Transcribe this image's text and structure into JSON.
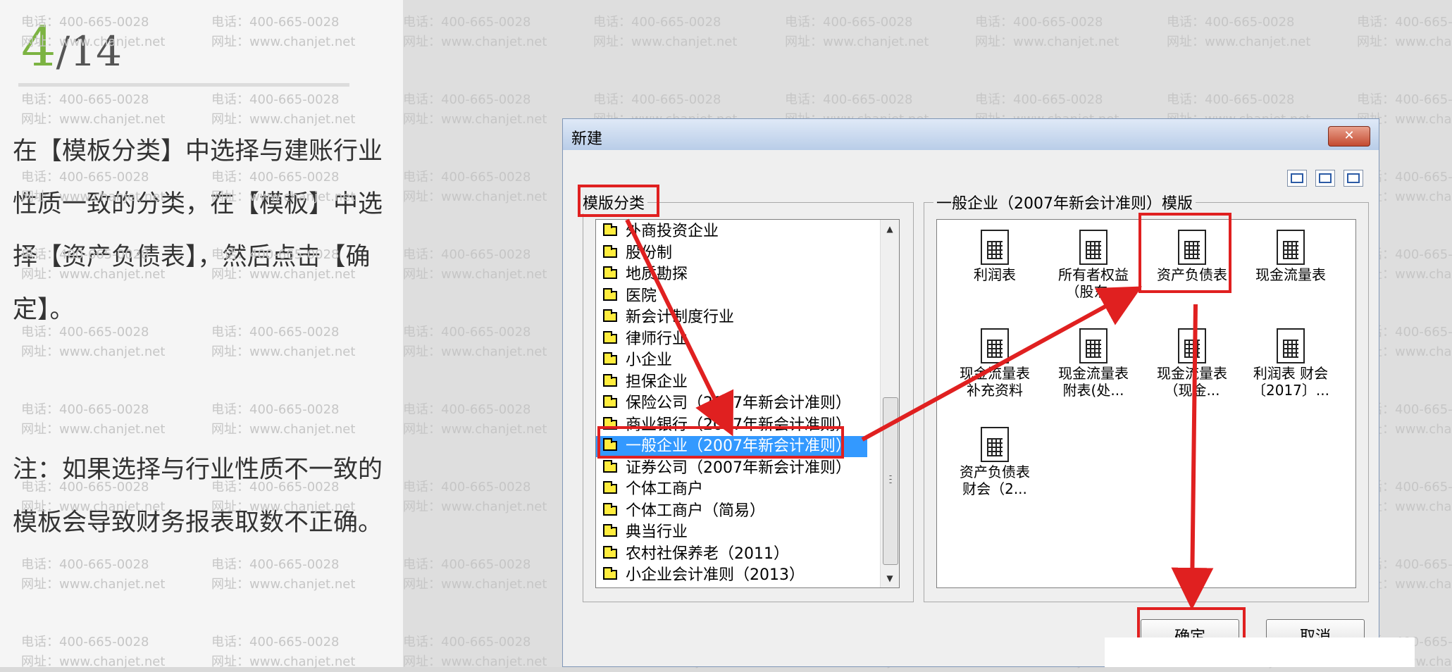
{
  "page_number": {
    "current": "4",
    "separator": "/",
    "total": "14"
  },
  "instructions": {
    "step": "在【模板分类】中选择与建账行业性质一致的分类，在【模板】中选择【资产负债表】，然后点击【确定】。",
    "note": "注：如果选择与行业性质不一致的模板会导致财务报表取数不正确。"
  },
  "watermark": {
    "phone": "电话：400-665-0028",
    "site": "网址：www.chanjet.net"
  },
  "dialog": {
    "title": "新建",
    "close_label": "✕",
    "category_group_label": "模版分类",
    "template_group_label": "一般企业（2007年新会计准则）模版",
    "categories": [
      "外商投资企业",
      "股份制",
      "地质勘探",
      "医院",
      "新会计制度行业",
      "律师行业",
      "小企业",
      "担保企业",
      "保险公司（2007年新会计准则）",
      "商业银行（2007年新会计准则）",
      "一般企业（2007年新会计准则）",
      "证券公司（2007年新会计准则）",
      "个体工商户",
      "个体工商户（简易）",
      "典当行业",
      "农村社保养老（2011）",
      "小企业会计准则（2013）"
    ],
    "selected_category": "一般企业（2007年新会计准则）",
    "templates": [
      [
        "利润表"
      ],
      [
        "所有者权益",
        "（股东..."
      ],
      [
        "资产负债表"
      ],
      [
        "现金流量表"
      ],
      [
        "现金流量表",
        "补充资料"
      ],
      [
        "现金流量表",
        "附表(处..."
      ],
      [
        "现金流量表",
        "（现金..."
      ],
      [
        "利润表 财会",
        "〔2017〕..."
      ],
      [
        "资产负债表",
        "财会（2..."
      ]
    ],
    "selected_template": "资产负债表",
    "ok_label": "确定",
    "cancel_label": "取消"
  },
  "colors": {
    "highlight": "#e02020",
    "accent_number": "#7cb342",
    "selection": "#3399ff"
  }
}
